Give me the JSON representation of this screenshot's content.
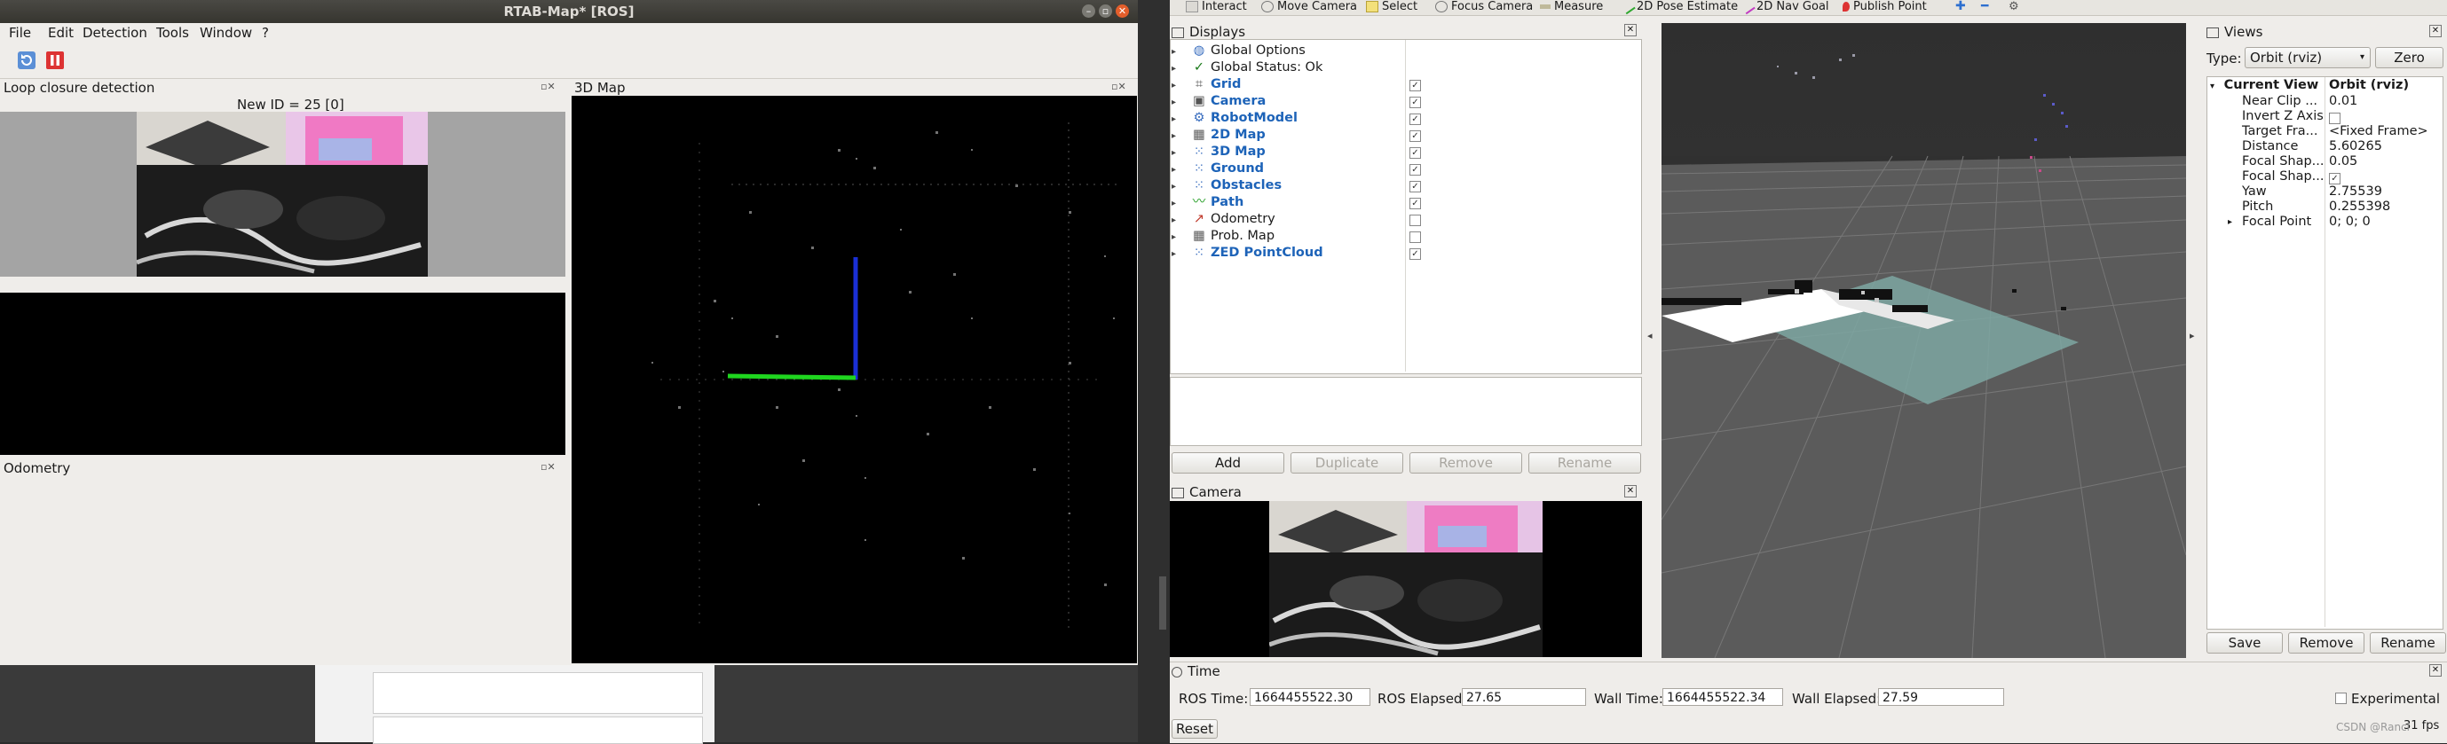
{
  "rtab": {
    "title": "RTAB-Map* [ROS]",
    "menu": [
      "File",
      "Edit",
      "Detection",
      "Tools",
      "Window",
      "?"
    ],
    "loop_panel_title": "Loop closure detection",
    "new_id_label": "New ID = 25 [0]",
    "odometry_panel_title": "Odometry",
    "map3d_panel_title": "3D Map",
    "dock_buttons": "▫✕",
    "window_controls": [
      "–",
      "▫",
      "✕"
    ]
  },
  "rviz": {
    "tools": [
      "Interact",
      "Move Camera",
      "Select",
      "Focus Camera",
      "Measure",
      "2D Pose Estimate",
      "2D Nav Goal",
      "Publish Point"
    ],
    "displays_title": "Displays",
    "displays": [
      {
        "label": "Global Options",
        "checked": null,
        "blue": false,
        "icon": "globe-icon"
      },
      {
        "label": "Global Status: Ok",
        "checked": null,
        "blue": false,
        "icon": "check-icon"
      },
      {
        "label": "Grid",
        "checked": true,
        "blue": true,
        "icon": "grid-icon"
      },
      {
        "label": "Camera",
        "checked": true,
        "blue": true,
        "icon": "camera-icon"
      },
      {
        "label": "RobotModel",
        "checked": true,
        "blue": true,
        "icon": "robot-icon"
      },
      {
        "label": "2D Map",
        "checked": true,
        "blue": true,
        "icon": "map-icon"
      },
      {
        "label": "3D Map",
        "checked": true,
        "blue": true,
        "icon": "cloud-icon"
      },
      {
        "label": "Ground",
        "checked": true,
        "blue": true,
        "icon": "cloud-icon"
      },
      {
        "label": "Obstacles",
        "checked": true,
        "blue": true,
        "icon": "cloud-icon"
      },
      {
        "label": "Path",
        "checked": true,
        "blue": true,
        "icon": "path-icon"
      },
      {
        "label": "Odometry",
        "checked": false,
        "blue": false,
        "icon": "odometry-icon"
      },
      {
        "label": "Prob. Map",
        "checked": false,
        "blue": false,
        "icon": "map-icon"
      },
      {
        "label": "ZED PointCloud",
        "checked": true,
        "blue": true,
        "icon": "cloud-icon"
      }
    ],
    "buttons": {
      "add": "Add",
      "duplicate": "Duplicate",
      "remove": "Remove",
      "rename": "Rename"
    },
    "camera_title": "Camera",
    "views": {
      "title": "Views",
      "type_label": "Type:",
      "type_value": "Orbit (rviz)",
      "zero": "Zero",
      "current_view": "Current View",
      "current_value": "Orbit (rviz)",
      "props": [
        {
          "name": "Near Clip ...",
          "value": "0.01"
        },
        {
          "name": "Invert Z Axis",
          "value": "",
          "checkbox": true,
          "checked": false
        },
        {
          "name": "Target Fra...",
          "value": "<Fixed Frame>"
        },
        {
          "name": "Distance",
          "value": "5.60265"
        },
        {
          "name": "Focal Shap...",
          "value": "0.05"
        },
        {
          "name": "Focal Shap...",
          "value": "",
          "checkbox": true,
          "checked": true
        },
        {
          "name": "Yaw",
          "value": "2.75539"
        },
        {
          "name": "Pitch",
          "value": "0.255398"
        },
        {
          "name": "Focal Point",
          "value": "0; 0; 0",
          "expandable": true
        }
      ],
      "save": "Save",
      "remove": "Remove",
      "rename": "Rename"
    },
    "time": {
      "title": "Time",
      "ros_time_label": "ROS Time:",
      "ros_time": "1664455522.30",
      "ros_elapsed_label": "ROS Elapsed:",
      "ros_elapsed": "27.65",
      "wall_time_label": "Wall Time:",
      "wall_time": "1664455522.34",
      "wall_elapsed_label": "Wall Elapsed:",
      "wall_elapsed": "27.59",
      "experimental": "Experimental",
      "reset": "Reset",
      "fps": "31 fps",
      "watermark": "CSDN @Rancl"
    }
  }
}
